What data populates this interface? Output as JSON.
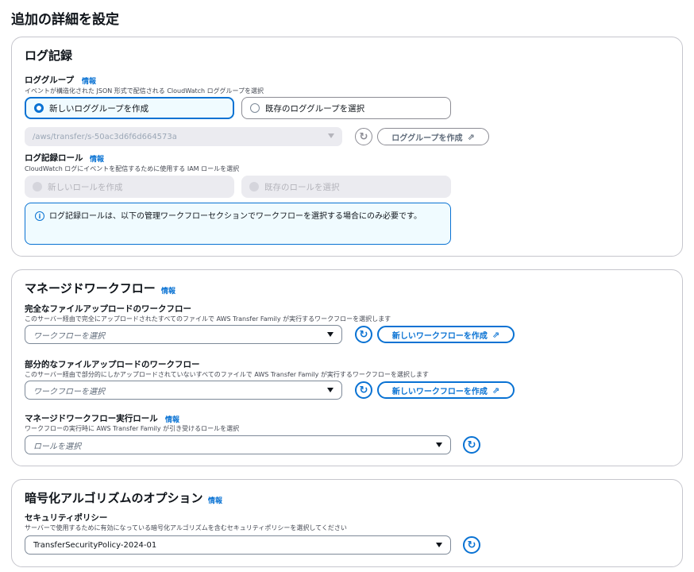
{
  "page_title": "追加の詳細を設定",
  "info": "情報",
  "logging": {
    "title": "ログ記録",
    "group_label": "ロググループ",
    "group_desc": "イベントが構造化された JSON 形式で配信される CloudWatch ロググループを選択",
    "opt_new_group": "新しいロググループを作成",
    "opt_existing_group": "既存のロググループを選択",
    "group_value": "/aws/transfer/s-50ac3d6f6d664573a",
    "create_group_button": "ロググループを作成",
    "role_label": "ログ記録ロール",
    "role_desc": "CloudWatch ログにイベントを配信するために使用する IAM ロールを選択",
    "opt_new_role": "新しいロールを作成",
    "opt_existing_role": "既存のロールを選択",
    "alert_text": "ログ記録ロールは、以下の管理ワークフローセクションでワークフローを選択する場合にのみ必要です。"
  },
  "workflow": {
    "title": "マネージドワークフロー",
    "full_label": "完全なファイルアップロードのワークフロー",
    "full_desc": "このサーバー経由で完全にアップロードされたすべてのファイルで AWS Transfer Family が実行するワークフローを選択します",
    "partial_label": "部分的なファイルアップロードのワークフロー",
    "partial_desc": "このサーバー経由で部分的にしかアップロードされていないすべてのファイルで AWS Transfer Family が実行するワークフローを選択します",
    "select_placeholder": "ワークフローを選択",
    "create_button": "新しいワークフローを作成",
    "role_label": "マネージドワークフロー実行ロール",
    "role_desc": "ワークフローの実行時に AWS Transfer Family が引き受けるロールを選択",
    "role_placeholder": "ロールを選択"
  },
  "encryption": {
    "title": "暗号化アルゴリズムのオプション",
    "policy_label": "セキュリティポリシー",
    "policy_desc": "サーバーで使用するために有効になっている暗号化アルゴリズムを含むセキュリティポリシーを選択してください",
    "policy_value": "TransferSecurityPolicy-2024-01"
  },
  "icons": {
    "refresh": "↻",
    "external": "⇗",
    "info_circle": "i"
  },
  "colors": {
    "accent": "#0972d3",
    "border": "#c6c6cd",
    "disabled_bg": "#ebebf0"
  }
}
